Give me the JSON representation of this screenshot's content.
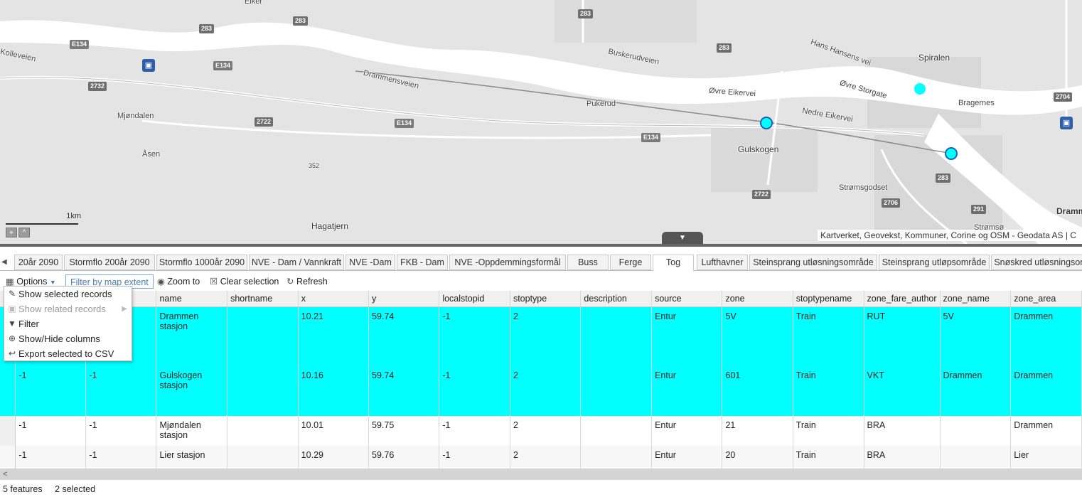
{
  "map": {
    "attribution": "Kartverket, Geovekst, Kommuner, Corine og OSM - Geodata AS | C",
    "scale_label": "1km",
    "place_labels": [
      "Eiker",
      "Spiralen",
      "Bragernes",
      "Mjøndalen",
      "Åsen",
      "Gulskogen",
      "Strømsgodset",
      "Hagatjern",
      "Drammen",
      "Strømsø",
      "Pukerud",
      "352",
      "Kolleveien"
    ],
    "road_labels": [
      "Hans Hansens vei",
      "Buskerudveien",
      "Drammensveien",
      "Øvre Eikervei",
      "Øvre Storgate",
      "Nedre Eikervei"
    ],
    "road_shields": [
      "283",
      "283",
      "283",
      "283",
      "283",
      "2732",
      "2722",
      "2722",
      "2704",
      "2706",
      "E134",
      "E134",
      "E134",
      "E134",
      "291"
    ],
    "selected_stop_color": "#00ffff",
    "train_icon": "train-station-icon"
  },
  "tabs": [
    "20år 2090",
    "Stormflo 200år 2090",
    "Stormflo 1000år 2090",
    "NVE - Dam / Vannkraft",
    "NVE -Dam",
    "FKB - Dam",
    "NVE -Oppdemmingsformål",
    "Buss",
    "Ferge",
    "Tog",
    "Lufthavner",
    "Steinsprang utløsningsområde",
    "Steinsprang utløpsområde",
    "Snøskred utløsningsom"
  ],
  "active_tab": "Tog",
  "toolbar": {
    "options_label": "Options",
    "filter_label": "Filter by map extent",
    "zoom_label": "Zoom to",
    "clear_label": "Clear selection",
    "refresh_label": "Refresh"
  },
  "options_menu": [
    {
      "label": "Show selected records",
      "icon": "pin-icon",
      "enabled": true
    },
    {
      "label": "Show related records",
      "icon": "related-icon",
      "enabled": false
    },
    {
      "label": "Filter",
      "icon": "filter-icon",
      "enabled": true
    },
    {
      "label": "Show/Hide columns",
      "icon": "plus-circle-icon",
      "enabled": true
    },
    {
      "label": "Export selected to CSV",
      "icon": "export-icon",
      "enabled": true
    }
  ],
  "table": {
    "columns": [
      "",
      "",
      "name",
      "shortname",
      "x",
      "y",
      "localstopid",
      "stoptype",
      "description",
      "source",
      "zone",
      "stoptypename",
      "zone_fare_author",
      "zone_name",
      "zone_area"
    ],
    "rows": [
      {
        "selected": true,
        "cells": [
          "",
          "",
          "Drammen stasjon",
          "",
          "10.21",
          "59.74",
          "-1",
          "2",
          "",
          "Entur",
          "5V",
          "Train",
          "RUT",
          "5V",
          "Drammen"
        ]
      },
      {
        "selected": true,
        "cells": [
          "-1",
          "-1",
          "Gulskogen stasjon",
          "",
          "10.16",
          "59.74",
          "-1",
          "2",
          "",
          "Entur",
          "601",
          "Train",
          "VKT",
          "Drammen",
          "Drammen"
        ]
      },
      {
        "selected": false,
        "cells": [
          "-1",
          "-1",
          "Mjøndalen stasjon",
          "",
          "10.01",
          "59.75",
          "-1",
          "2",
          "",
          "Entur",
          "21",
          "Train",
          "BRA",
          "",
          "Drammen"
        ]
      },
      {
        "selected": false,
        "cells": [
          "-1",
          "-1",
          "Lier stasjon",
          "",
          "10.29",
          "59.76",
          "-1",
          "2",
          "",
          "Entur",
          "20",
          "Train",
          "BRA",
          "",
          "Lier"
        ]
      }
    ]
  },
  "status": {
    "features": "5 features",
    "selected": "2 selected"
  },
  "colors": {
    "selection": "#00ffff",
    "map_bg": "#e4e4e4",
    "river": "#ffffff",
    "filter_accent": "#4a7fb8"
  }
}
